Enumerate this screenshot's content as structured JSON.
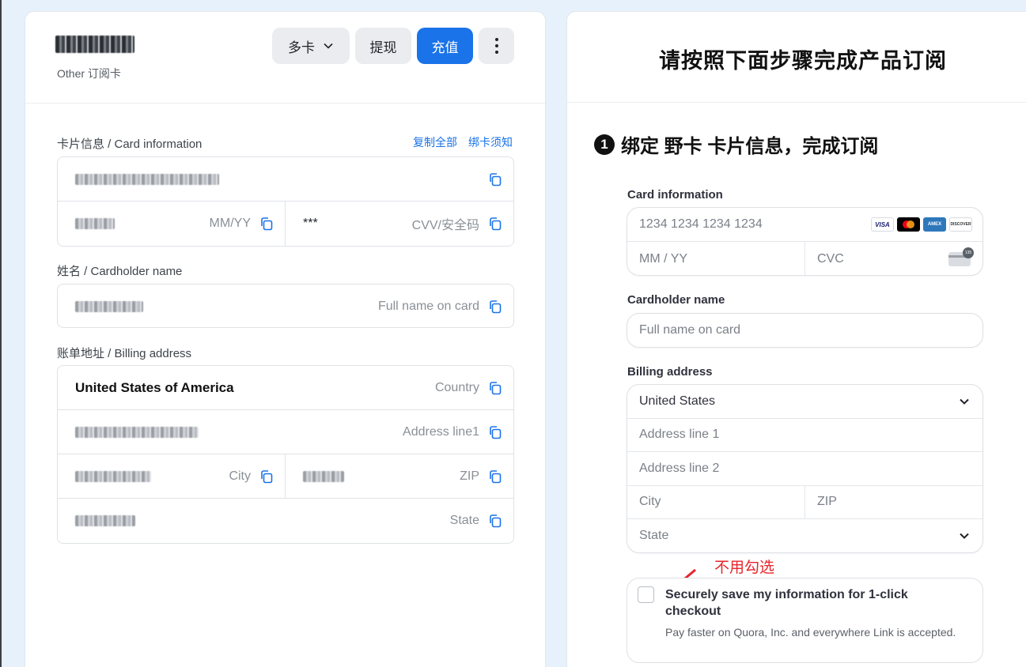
{
  "left_panel": {
    "subtitle": "Other 订阅卡",
    "header_buttons": {
      "multi_card": "多卡",
      "withdraw": "提现",
      "recharge": "充值"
    },
    "card_info": {
      "label": "卡片信息 / Card information",
      "copy_all": "复制全部",
      "binding_notice": "绑卡须知",
      "expiry_hint": "MM/YY",
      "cvv_value": "***",
      "cvv_hint": "CVV/安全码"
    },
    "cardholder": {
      "label": "姓名 / Cardholder name",
      "hint": "Full name on card"
    },
    "billing": {
      "label": "账单地址 / Billing address",
      "country_value": "United States of America",
      "country_hint": "Country",
      "address_hint": "Address line1",
      "city_hint": "City",
      "zip_hint": "ZIP",
      "state_hint": "State"
    }
  },
  "right_panel": {
    "title": "请按照下面步骤完成产品订阅",
    "step_number": "1",
    "step_title": "绑定 野卡 卡片信息，完成订阅",
    "card_information": {
      "label": "Card information",
      "number_placeholder": "1234 1234 1234 1234",
      "expiry_placeholder": "MM / YY",
      "cvc_placeholder": "CVC",
      "brands": [
        "VISA",
        "Mastercard",
        "AMEX",
        "DISCOVER"
      ]
    },
    "cardholder": {
      "label": "Cardholder name",
      "placeholder": "Full name on card"
    },
    "billing": {
      "label": "Billing address",
      "country": "United States",
      "address1_placeholder": "Address line 1",
      "address2_placeholder": "Address line 2",
      "city_placeholder": "City",
      "zip_placeholder": "ZIP",
      "state_placeholder": "State"
    },
    "annotation": "不用勾选",
    "save_info": {
      "title": "Securely save my information for 1-click checkout",
      "description": "Pay faster on Quora, Inc. and everywhere Link is accepted."
    }
  },
  "colors": {
    "accent": "#1a73e8",
    "annotation_red": "#e8242a",
    "page_bg": "#e6f1fb"
  }
}
